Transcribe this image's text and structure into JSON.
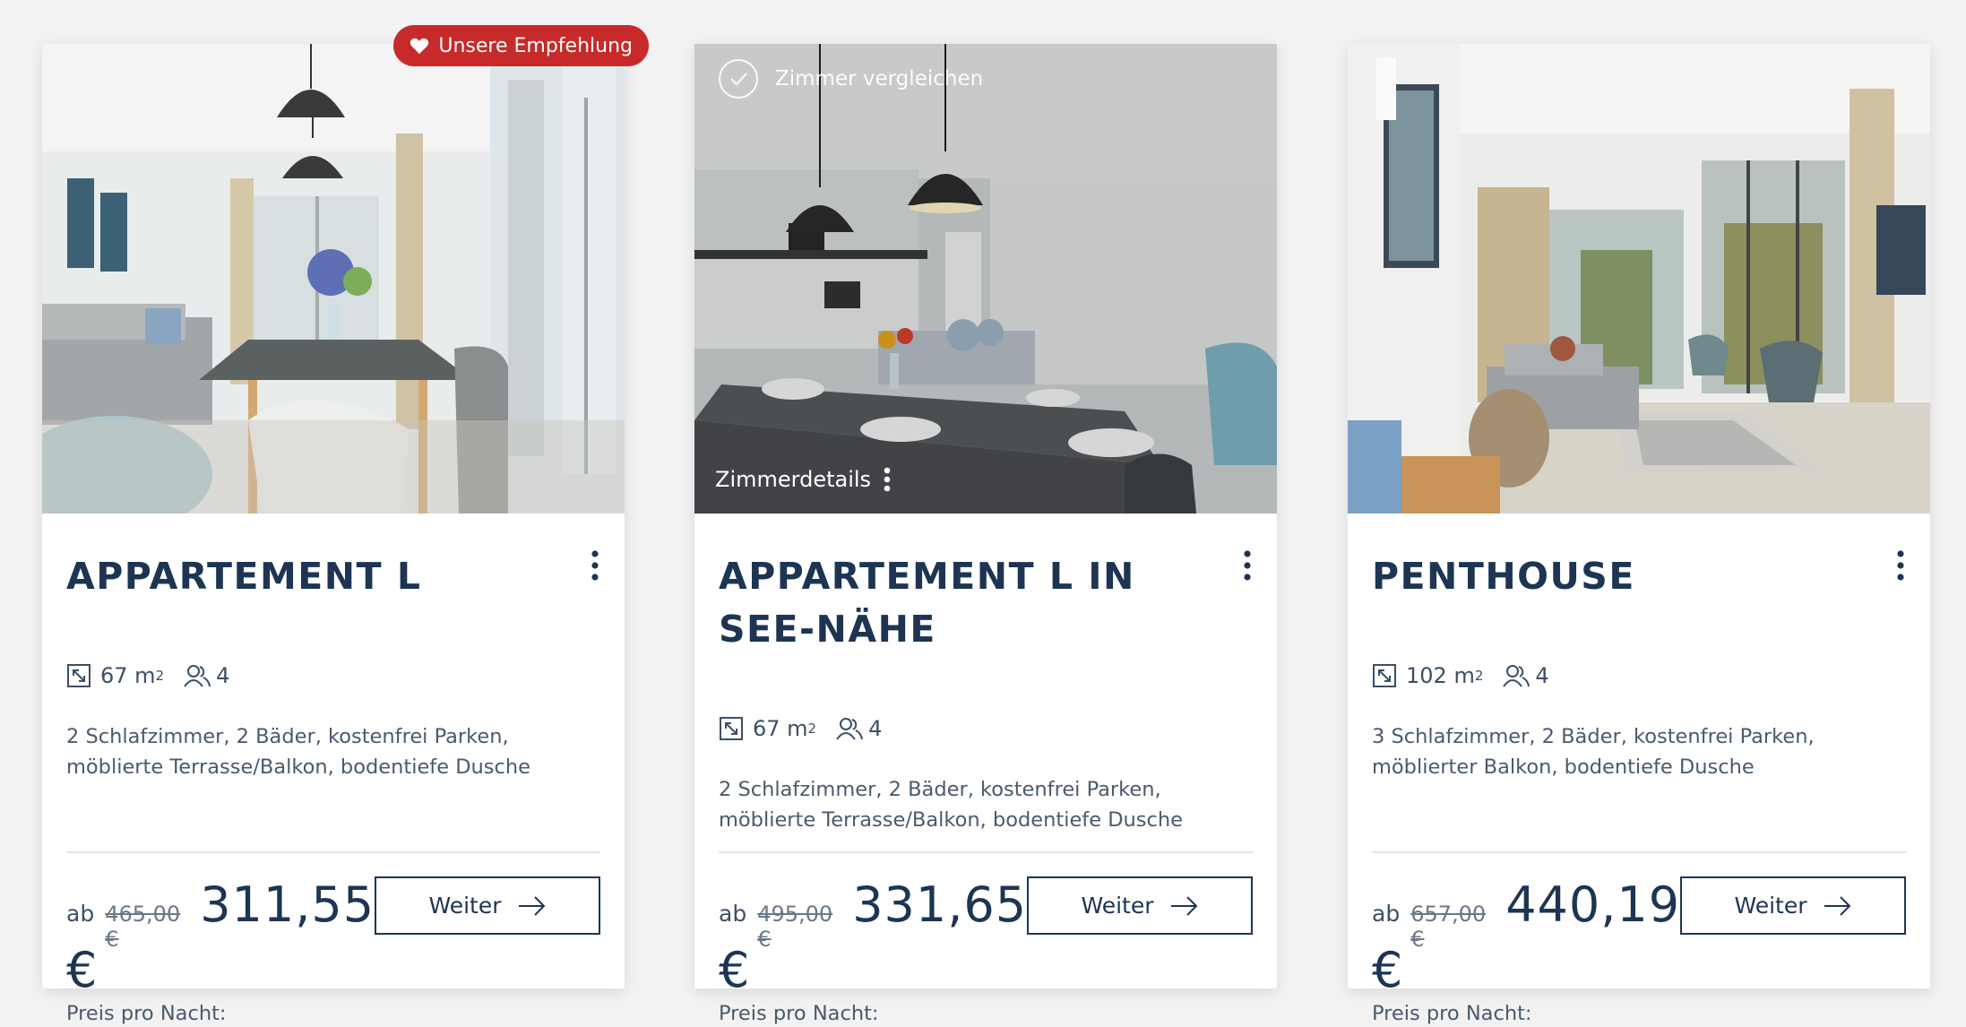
{
  "recommendation_badge": "Unsere Empfehlung",
  "compare_label": "Zimmer vergleichen",
  "details_label": "Zimmerdetails",
  "cards": [
    {
      "title": "APPARTEMENT L",
      "size": "67 m",
      "size_sup": "2",
      "guests": "4",
      "description": "2 Schlafzimmer, 2 Bäder, kostenfrei Parken, möblierte Terrasse/Balkon, bodentiefe Dusche",
      "ab": "ab",
      "old_price": "465,00 €",
      "price": "311,55",
      "currency": "€",
      "per_night": "Preis pro Nacht:",
      "button": "Weiter"
    },
    {
      "title": "APPARTEMENT L IN SEE-NÄHE",
      "size": "67 m",
      "size_sup": "2",
      "guests": "4",
      "description": "2 Schlafzimmer, 2 Bäder, kostenfrei Parken, möblierte Terrasse/Balkon, bodentiefe Dusche",
      "ab": "ab",
      "old_price": "495,00 €",
      "price": "331,65",
      "currency": "€",
      "per_night": "Preis pro Nacht:",
      "button": "Weiter"
    },
    {
      "title": "PENTHOUSE",
      "size": "102 m",
      "size_sup": "2",
      "guests": "4",
      "description": "3 Schlafzimmer, 2 Bäder, kostenfrei Parken, möblierter Balkon, bodentiefe Dusche",
      "ab": "ab",
      "old_price": "657,00 €",
      "price": "440,19",
      "currency": "€",
      "per_night": "Preis pro Nacht:",
      "button": "Weiter"
    }
  ],
  "colors": {
    "navy": "#1d3553",
    "badge_red": "#c62a2a",
    "page_bg": "#f2f2f2"
  }
}
